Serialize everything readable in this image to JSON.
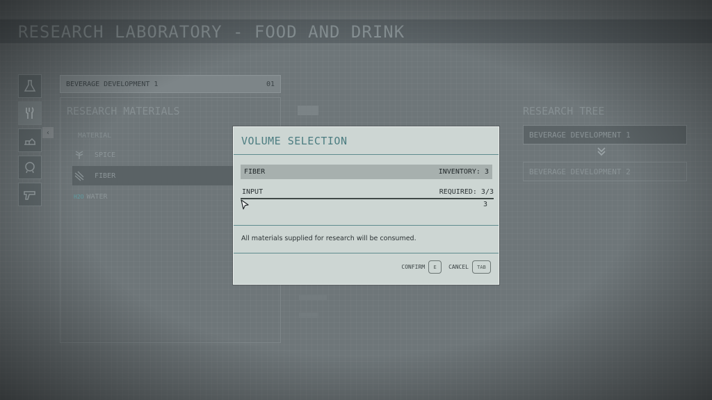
{
  "background": {
    "screen_title": "RESEARCH LABORATORY - FOOD AND DRINK",
    "project_header": {
      "name": "BEVERAGE DEVELOPMENT 1",
      "tag": "01"
    },
    "left_categories": [
      {
        "icon": "flask-icon",
        "active": false
      },
      {
        "icon": "utensils-icon",
        "active": true
      },
      {
        "icon": "outpost-icon",
        "active": false
      },
      {
        "icon": "helmet-icon",
        "active": false
      },
      {
        "icon": "pistol-icon",
        "active": false
      }
    ],
    "collapse_glyph": "‹",
    "materials_heading": "RESEARCH MATERIALS",
    "material_column": "MATERIAL",
    "materials": [
      {
        "name": "SPICE",
        "icon": "leaf-icon",
        "badge": "",
        "selected": false
      },
      {
        "name": "FIBER",
        "icon": "fiber-icon",
        "badge": "",
        "selected": true
      },
      {
        "name": "WATER",
        "icon": "water-icon",
        "badge": "H2O",
        "selected": false
      }
    ],
    "research_tree_heading": "RESEARCH TREE",
    "research_tree": [
      {
        "name": "BEVERAGE DEVELOPMENT 1",
        "current": true
      },
      {
        "name": "BEVERAGE DEVELOPMENT 2",
        "current": false
      }
    ]
  },
  "modal": {
    "title": "VOLUME SELECTION",
    "material_name": "FIBER",
    "inventory_text": "INVENTORY: 3",
    "input_label": "INPUT",
    "required_text": "REQUIRED: 3/3",
    "slider_value": "3",
    "slider_fraction": 1.0,
    "note": "All materials supplied for research will be consumed.",
    "confirm_label": "CONFIRM",
    "confirm_key": "E",
    "cancel_label": "CANCEL",
    "cancel_key": "TAB"
  },
  "colors": {
    "modal_bg": "#cdd6d3",
    "accent_teal": "#4b7c80",
    "scene_bg": "#6e7679"
  }
}
